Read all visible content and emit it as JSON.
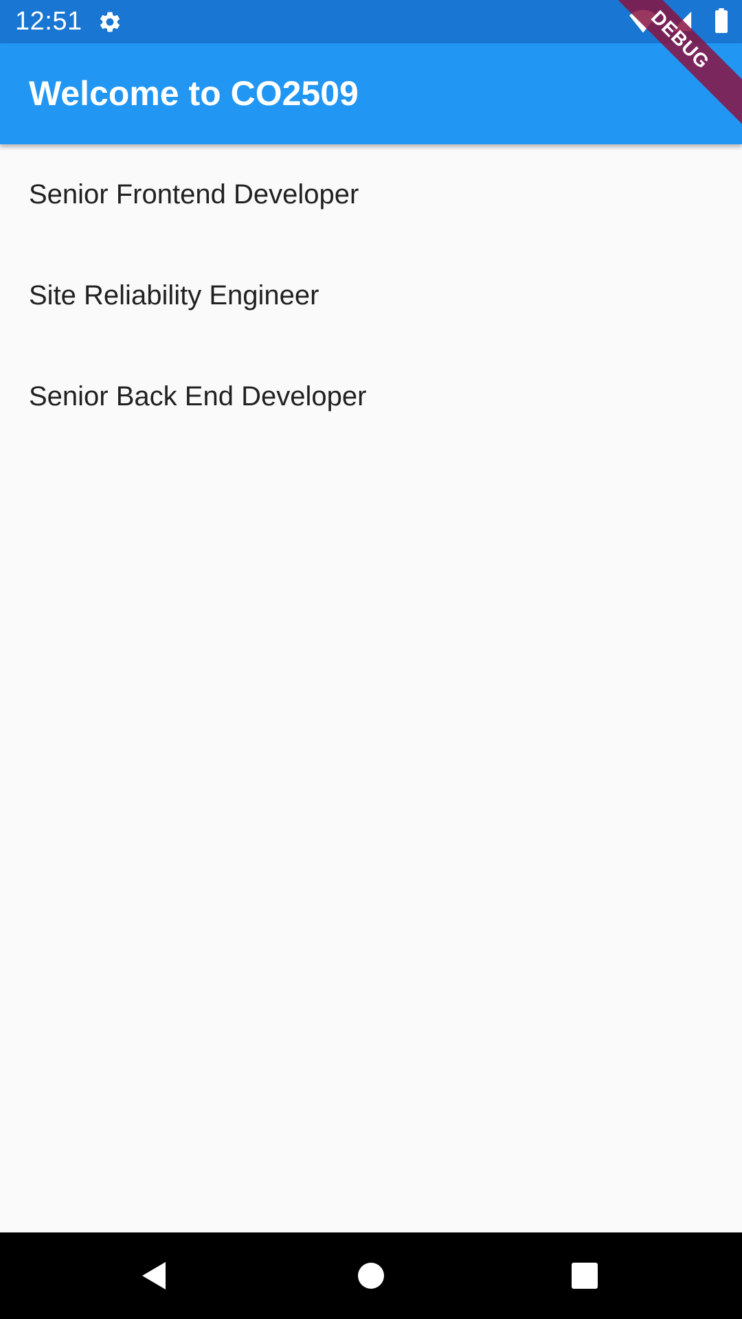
{
  "status_bar": {
    "time": "12:51",
    "icons": [
      "gear-icon",
      "wifi-icon",
      "signal-icon",
      "battery-icon"
    ]
  },
  "app_bar": {
    "title": "Welcome to CO2509"
  },
  "debug_banner": {
    "label": "DEBUG"
  },
  "jobs": [
    {
      "title": "Senior Frontend Developer"
    },
    {
      "title": "Site Reliability Engineer"
    },
    {
      "title": "Senior Back End Developer"
    }
  ],
  "nav_bar": {
    "buttons": [
      "back-icon",
      "home-icon",
      "recents-icon"
    ]
  },
  "colors": {
    "status_bar": "#1976d2",
    "app_bar": "#2196f3",
    "background": "#fafafa",
    "text": "#212121",
    "debug_ribbon": "#881442"
  }
}
